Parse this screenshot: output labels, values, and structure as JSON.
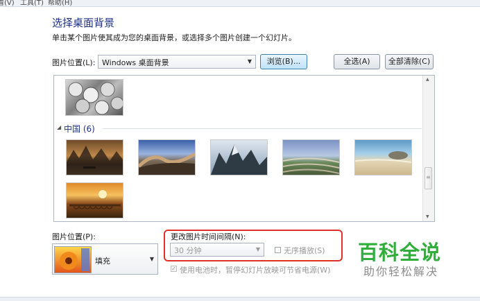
{
  "menu": [
    "看(V)",
    "工具(T)",
    "帮助(H)"
  ],
  "title": "选择桌面背景",
  "description": "单击某个图片使其成为您的桌面背景，或选择多个图片创建一个幻灯片。",
  "location": {
    "label": "图片位置(L):",
    "value": "Windows 桌面背景",
    "browse_label": "浏览(B)...",
    "select_all_label": "全选(A)",
    "clear_all_label": "全部清除(C)"
  },
  "gallery": {
    "group_label": "中国 (6)",
    "group_collapse_glyph": "◢",
    "scroll_up": "▲",
    "scroll_down": "▼",
    "scroll_grip": "≡"
  },
  "position": {
    "label": "图片位置(P):",
    "value": "填充"
  },
  "interval": {
    "label": "更改图片时间间隔(N):",
    "value": "30 分钟",
    "shuffle_label": "无序播放(S)",
    "battery_label": "使用电池时，暂停幻灯片放映可节省电源(W)",
    "battery_checked": true
  },
  "watermark": {
    "title": "百科全说",
    "subtitle": "助你轻松解决"
  },
  "colors": {
    "title": "#1e3287",
    "highlight": "#e0302b",
    "watermark": "#2fae3a"
  }
}
